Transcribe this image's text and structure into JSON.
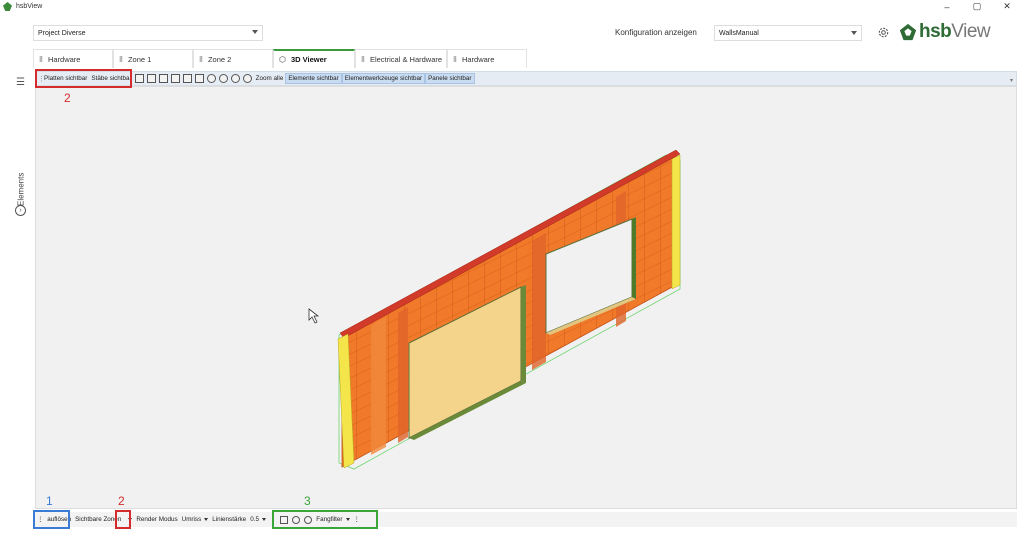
{
  "window": {
    "title": "hsbView",
    "controls": {
      "minimize": "–",
      "maximize": "▢",
      "close": "✕"
    }
  },
  "header": {
    "project": "Project Diverse",
    "config_label": "Konfiguration anzeigen",
    "config_value": "WallsManual",
    "logo_hsb": "hsb",
    "logo_view": "View"
  },
  "tabs": [
    {
      "label": "Hardware",
      "icon": "table-icon",
      "active": false
    },
    {
      "label": "Zone 1",
      "icon": "table-icon",
      "active": false
    },
    {
      "label": "Zone 2",
      "icon": "table-icon",
      "active": false
    },
    {
      "label": "3D Viewer",
      "icon": "cube-icon",
      "active": true
    },
    {
      "label": "Electrical & Hardware",
      "icon": "table-icon",
      "active": false
    },
    {
      "label": "Hardware",
      "icon": "table-icon",
      "active": false
    }
  ],
  "sidebar": {
    "label": "Elements"
  },
  "toolbar_top": {
    "plates_visible": "Platten sichtbar",
    "beams_visible": "Stäbe sichtbar",
    "zoom_all": "Zoom alle",
    "elements_visible": "Elemente sichtbar",
    "element_tools_visible": "Elementwerkzeuge sichtbar",
    "panels_visible": "Panele sichtbar"
  },
  "toolbar_bottom": {
    "dissolve": "auflösen",
    "visible_zones": "Sichtbare Zonen",
    "render_mode_label": "Render Modus",
    "render_mode_value": "Umriss",
    "line_width_label": "Linienstärke",
    "line_width_value": "0.5",
    "snap_filter": "Fangfilter"
  },
  "annotations": {
    "blue_1": "1",
    "red_2_top": "2",
    "red_2_bottom": "2",
    "green_3": "3"
  },
  "colors": {
    "annotation_red": "#d42c2c",
    "annotation_blue": "#3a7bd5",
    "annotation_green": "#3aa63a",
    "brand_green": "#2f6b35",
    "toggled_bg": "#c9dcf1"
  }
}
